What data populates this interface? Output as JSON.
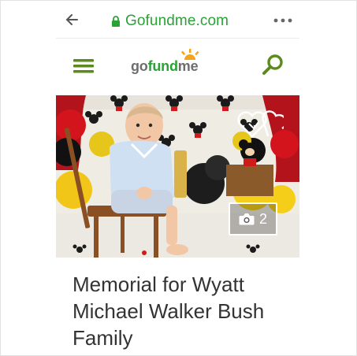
{
  "browser": {
    "url": "Gofundme.com",
    "back_icon": "arrow-left-icon",
    "lock_icon": "lock-icon",
    "more_icon": "more-horizontal-icon"
  },
  "header": {
    "logo_text_prefix": "go",
    "logo_text_accent": "fund",
    "logo_text_suffix": "me",
    "menu_icon": "hamburger-menu-icon",
    "search_icon": "search-icon"
  },
  "campaign": {
    "photo_count": "2",
    "title": "Memorial for Wyatt Michael Walker Bush Family"
  },
  "colors": {
    "brand_green": "#2aa335",
    "menu_green": "#5c8a1e",
    "title_text": "#333333"
  }
}
